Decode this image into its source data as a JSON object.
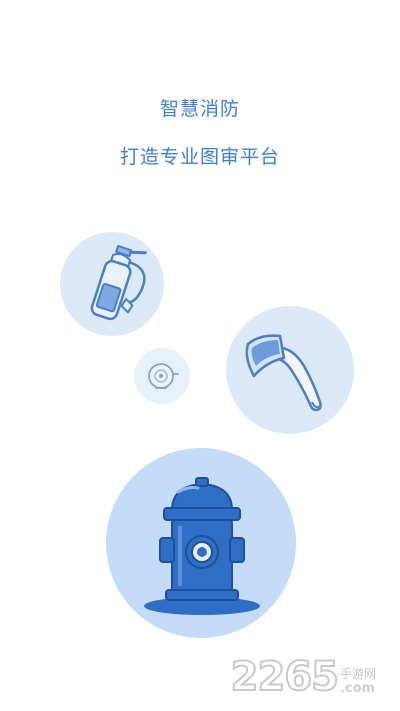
{
  "intro": {
    "title": "智慧消防",
    "subtitle": "打造专业图审平台"
  },
  "illustrations": [
    {
      "icon": "fire-extinguisher-icon"
    },
    {
      "icon": "axe-icon"
    },
    {
      "icon": "fire-alarm-bell-icon"
    },
    {
      "icon": "fire-hydrant-icon"
    }
  ],
  "watermark": {
    "number": "2265",
    "site": "手游网",
    "suffix": ".com"
  },
  "colors": {
    "accent": "#3d7fd6",
    "bubble_light": "#dce9f9",
    "bubble_hydrant": "#c4dcf7",
    "hydrant_blue": "#2f6ec6"
  }
}
